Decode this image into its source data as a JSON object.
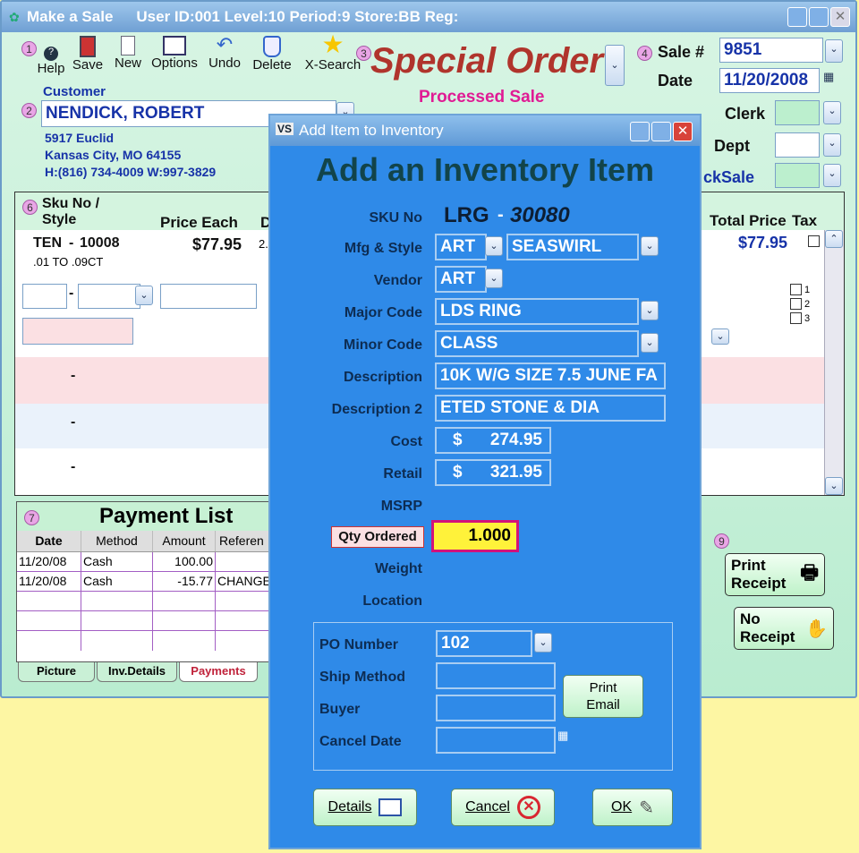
{
  "window": {
    "title": "Make a Sale",
    "info": "User ID:001 Level:10 Period:9 Store:BB Reg:"
  },
  "toolbar": {
    "num": "1",
    "help": "Help",
    "save": "Save",
    "new": "New",
    "options": "Options",
    "undo": "Undo",
    "delete": "Delete",
    "xsearch": "X-Search"
  },
  "order": {
    "num": "3",
    "title": "Special Order",
    "status": "Processed Sale"
  },
  "sale": {
    "num": "4",
    "sale_label": "Sale #",
    "sale_no": "9851",
    "date_label": "Date",
    "date": "11/20/2008",
    "clerk_label": "Clerk",
    "dept_label": "Dept",
    "quicksale_label": "ckSale"
  },
  "customer": {
    "label": "Customer",
    "num": "2",
    "name": "NENDICK, ROBERT",
    "addr1": "5917 Euclid",
    "addr2": "Kansas City, MO  64155",
    "phone": "H:(816) 734-4009  W:997-3829"
  },
  "items": {
    "num": "6",
    "col_sku": "Sku No /",
    "col_style": "Style",
    "col_price": "Price Each",
    "col_d": "D",
    "col_total": "Total Price",
    "col_tax": "Tax",
    "row1_sku": "TEN",
    "row1_dash": "-",
    "row1_no": "10008",
    "row1_desc": ".01 TO .09CT",
    "row1_price": "$77.95",
    "row1_extra": "2.",
    "row1_total": "$77.95",
    "dashes": [
      "-",
      "-",
      "-",
      "-"
    ],
    "checks": [
      "1",
      "2",
      "3"
    ]
  },
  "payments": {
    "num": "7",
    "title": "Payment List",
    "headers": [
      "Date",
      "Method",
      "Amount",
      "Referen"
    ],
    "rows": [
      {
        "date": "11/20/08",
        "method": "Cash",
        "amount": "100.00",
        "ref": ""
      },
      {
        "date": "11/20/08",
        "method": "Cash",
        "amount": "-15.77",
        "ref": "CHANGE"
      }
    ]
  },
  "tabs": [
    "Picture",
    "Inv.Details",
    "Payments"
  ],
  "receipt": {
    "num": "9",
    "print": "Print\nReceipt",
    "none": "No\nReceipt"
  },
  "dialog": {
    "title": "Add Item to Inventory",
    "heading": "Add an Inventory Item",
    "sku_label": "SKU No",
    "sku_prefix": "LRG",
    "sku_dash": "-",
    "sku_number": "30080",
    "mfg_label": "Mfg  & Style",
    "mfg": "ART",
    "style": "SEASWIRL",
    "vendor_label": "Vendor",
    "vendor": "ART",
    "major_label": "Major Code",
    "major": "LDS RING",
    "minor_label": "Minor Code",
    "minor": "CLASS",
    "desc_label": "Description",
    "desc": "10K W/G SIZE 7.5 JUNE FA",
    "desc2_label": "Description 2",
    "desc2": "ETED STONE & DIA",
    "cost_label": "Cost",
    "cost_sym": "$",
    "cost": "274.95",
    "retail_label": "Retail",
    "retail_sym": "$",
    "retail": "321.95",
    "msrp_label": "MSRP",
    "qty_label": "Qty Ordered",
    "qty": "1.000",
    "weight_label": "Weight",
    "location_label": "Location",
    "po_label": "PO Number",
    "po": "102",
    "ship_label": "Ship Method",
    "buyer_label": "Buyer",
    "cancel_label": "Cancel Date",
    "print_email": "Print\nEmail",
    "details": "Details",
    "cancel": "Cancel",
    "ok": "OK"
  }
}
